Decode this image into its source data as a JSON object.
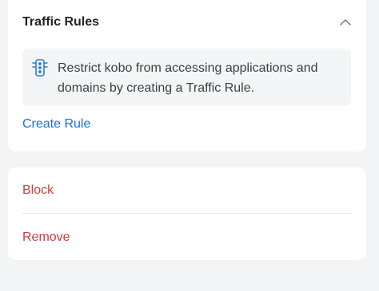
{
  "traffic_rules": {
    "title": "Traffic Rules",
    "collapse_icon": "chevron-up-icon",
    "info": {
      "icon": "traffic-light-icon",
      "text": "Restrict kobo from accessing applications and domains by creating a Traffic Rule."
    },
    "create_rule_label": "Create Rule"
  },
  "actions": {
    "block_label": "Block",
    "remove_label": "Remove"
  },
  "colors": {
    "link": "#1c6fd6",
    "danger": "#d13b3b",
    "icon": "#2f7bdc"
  }
}
